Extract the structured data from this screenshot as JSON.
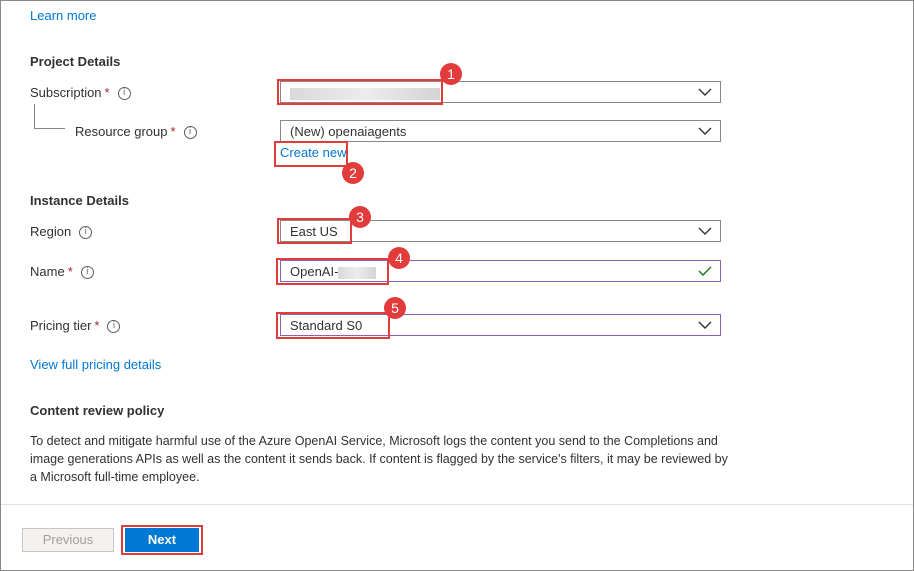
{
  "links": {
    "learn_more": "Learn more",
    "create_new": "Create new",
    "pricing_details": "View full pricing details"
  },
  "project": {
    "heading": "Project Details",
    "subscription_label": "Subscription",
    "subscription_value": "",
    "resource_group_label": "Resource group",
    "resource_group_value": "(New) openaiagents"
  },
  "instance": {
    "heading": "Instance Details",
    "region_label": "Region",
    "region_value": "East US",
    "name_label": "Name",
    "name_value": "OpenAI-",
    "pricing_label": "Pricing tier",
    "pricing_value": "Standard S0"
  },
  "policy": {
    "heading": "Content review policy",
    "text": "To detect and mitigate harmful use of the Azure OpenAI Service, Microsoft logs the content you send to the Completions and image generations APIs as well as the content it sends back. If content is flagged by the service's filters, it may be reviewed by a Microsoft full-time employee."
  },
  "required_marker": "*",
  "info_glyph": "i",
  "badges": [
    "1",
    "2",
    "3",
    "4",
    "5"
  ],
  "buttons": {
    "previous": "Previous",
    "next": "Next"
  },
  "colors": {
    "link": "#0078d4",
    "highlight": "#e23b3b",
    "primary": "#0078d4",
    "valid": "#107c10"
  },
  "icons": [
    "info-icon",
    "chevron-down-icon",
    "checkmark-icon"
  ]
}
